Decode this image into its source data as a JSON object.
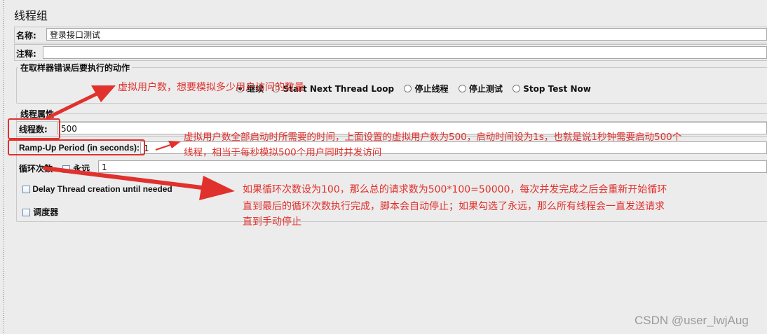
{
  "panel": {
    "title": "线程组"
  },
  "name_row": {
    "label": "名称:",
    "value": "登录接口测试"
  },
  "comment_row": {
    "label": "注释:",
    "value": ""
  },
  "error_action": {
    "legend": "在取样器错误后要执行的动作",
    "options": [
      "继续",
      "Start Next Thread Loop",
      "停止线程",
      "停止测试",
      "Stop Test Now"
    ],
    "selected": 0
  },
  "thread_props": {
    "legend": "线程属性",
    "threads_label": "线程数:",
    "threads_value": "500",
    "rampup_label": "Ramp-Up Period (in seconds):",
    "rampup_value": "1",
    "loop_label": "循环次数",
    "forever_label": "永远",
    "loop_value": "1",
    "delay_label": "Delay Thread creation until needed",
    "scheduler_label": "调度器"
  },
  "annotations": {
    "users_note": "虚拟用户数，想要模拟多少用户访问的数量",
    "rampup_note_line1": "虚拟用户数全部启动时所需要的时间，上面设置的虚拟用户数为500，启动时间设为1s，也就是说1秒钟需要启动500个",
    "rampup_note_line2": "线程，相当于每秒模拟500个用户同时并发访问",
    "loop_note_line1": "如果循环次数设为100，那么总的请求数为500*100=50000，每次并发完成之后会重新开始循环",
    "loop_note_line2": "直到最后的循环次数执行完成，脚本会自动停止；如果勾选了永远，那么所有线程会一直发送请求",
    "loop_note_line3": "直到手动停止",
    "color": "#e0312d"
  },
  "watermark": "CSDN @user_lwjAug"
}
